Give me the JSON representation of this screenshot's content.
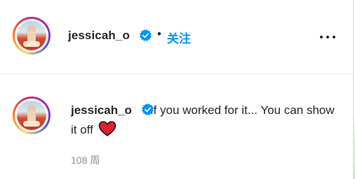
{
  "post_header": {
    "username": "jessicah_o",
    "separator": "•",
    "follow_label": "关注",
    "avatar_icon": "profile-photo",
    "verified_icon": "verified-badge-icon",
    "more_icon": "more-options-icon"
  },
  "comment": {
    "username": "jessicah_o",
    "text": "If you worked for it... You can show it off",
    "emoji_icon": "red-heart-icon",
    "timestamp": "108 周"
  },
  "colors": {
    "accent": "#0095f6",
    "verified": "#0095f6",
    "heart": "#e0202a",
    "muted": "#8e8e8e"
  }
}
